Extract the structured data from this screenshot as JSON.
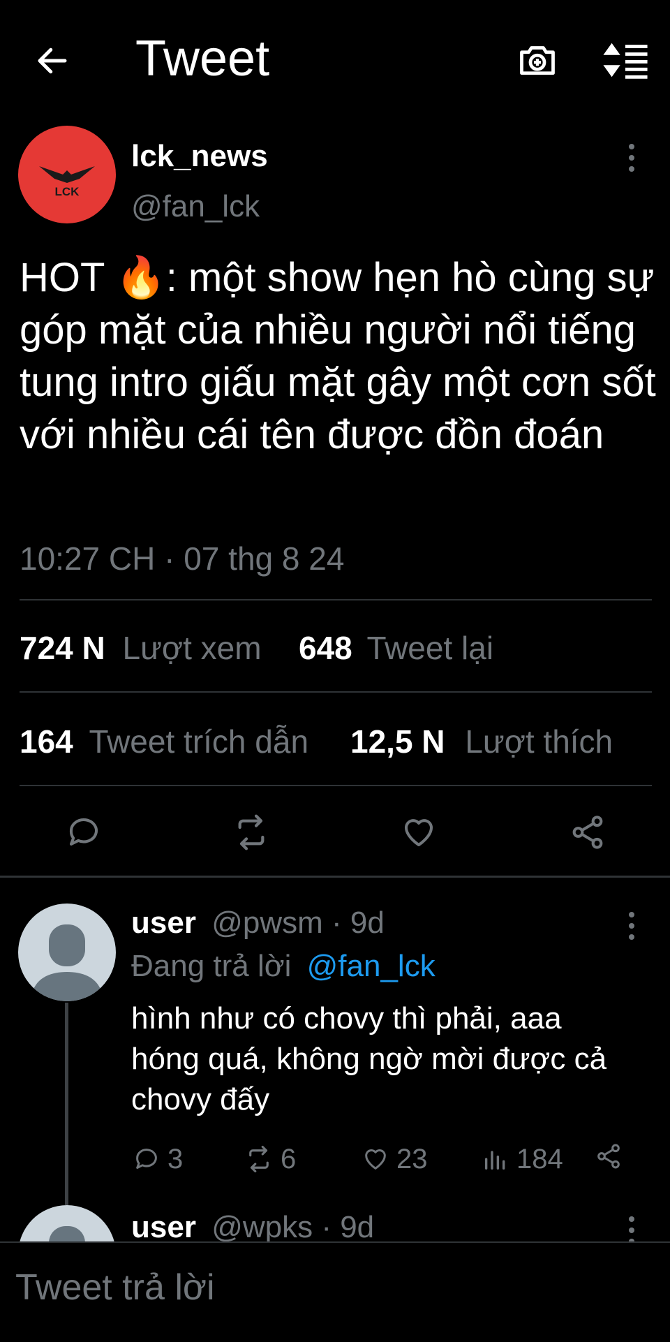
{
  "header": {
    "title": "Tweet",
    "back_icon": "arrow-left-icon",
    "camera_icon": "camera-plus-icon",
    "sort_icon": "sort-icon"
  },
  "tweet": {
    "avatar_text": "LCK",
    "author_name": "lck_news",
    "author_handle": "@fan_lck",
    "text": "HOT 🔥: một show hẹn hò cùng sự góp mặt của nhiều người nổi tiếng tung intro giấu mặt gây một cơn sốt với nhiều cái tên được đồn đoán",
    "timestamp": "10:27 CH · 07 thg 8 24",
    "stats": {
      "views_count": "724 N",
      "views_label": "Lượt xem",
      "retweets_count": "648",
      "retweets_label": "Tweet lại",
      "quotes_count": "164",
      "quotes_label": "Tweet trích dẫn",
      "likes_count": "12,5 N",
      "likes_label": "Lượt thích"
    }
  },
  "replies": [
    {
      "name": "user",
      "handle_time": "@pwsm · 9d",
      "replying_prefix": "Đang trả lời",
      "replying_to": "@fan_lck",
      "text": "hình như có chovy thì phải, aaa hóng quá, không ngờ mời được cả chovy đấy",
      "replies": "3",
      "retweets": "6",
      "likes": "23",
      "views": "184"
    },
    {
      "name": "user",
      "handle_time": "@wpks · 9d"
    }
  ],
  "compose": {
    "placeholder": "Tweet trả lời"
  },
  "colors": {
    "background": "#000000",
    "secondary_text": "#71767b",
    "link": "#1d9bf0",
    "avatar_red": "#e53935",
    "divider": "#2f3336"
  }
}
